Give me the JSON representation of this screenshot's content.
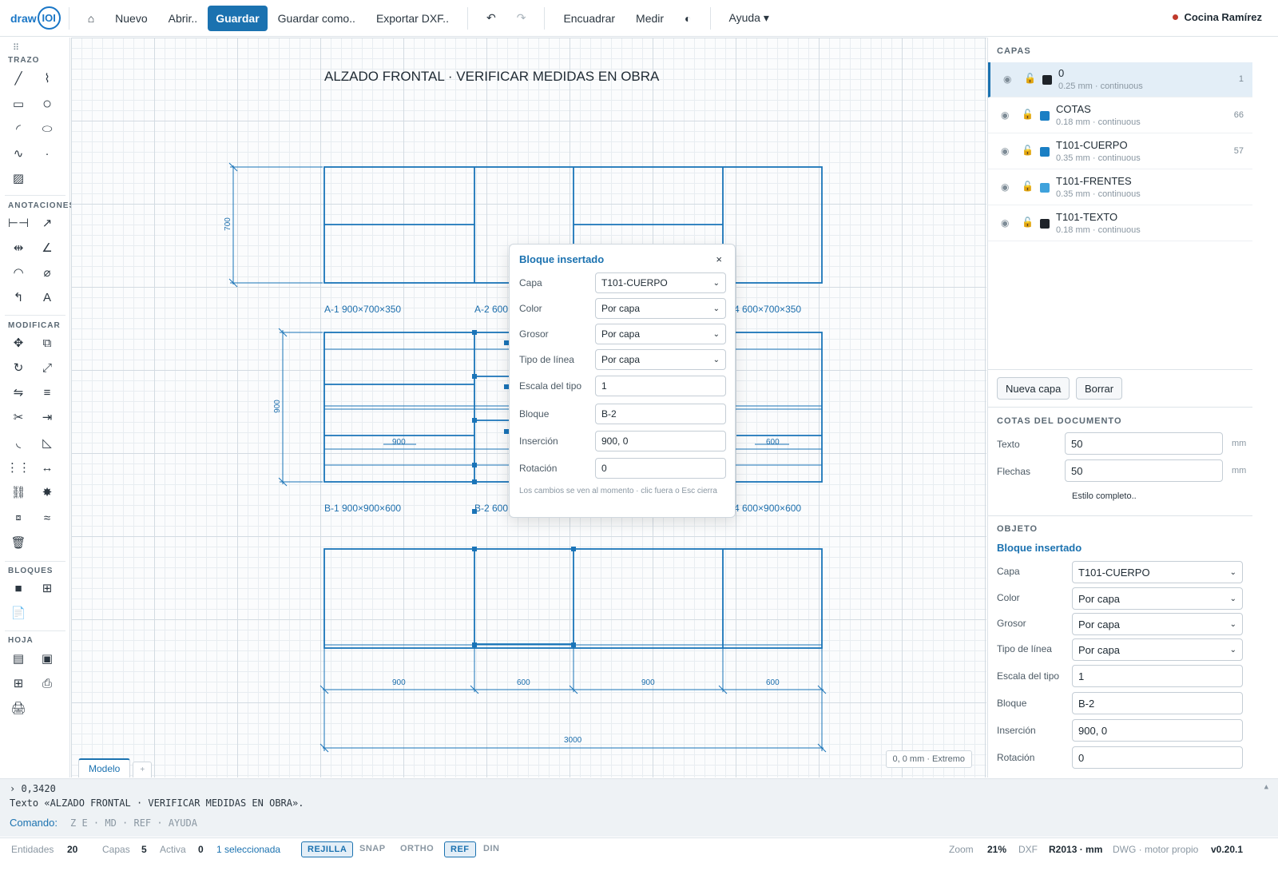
{
  "app": {
    "logo_text": "draw",
    "logo_mark": "IOI",
    "user": "Cocina Ramírez"
  },
  "toolbar": {
    "home_icon": "⌂",
    "new": "Nuevo",
    "open": "Abrir..",
    "save": "Guardar",
    "save_as": "Guardar como..",
    "export_dxf": "Exportar DXF..",
    "undo_icon": "↶",
    "redo_icon": "↷",
    "fit": "Encuadrar",
    "measure": "Medir",
    "theme_icon": "◐",
    "help": "Ayuda ▾"
  },
  "tools": {
    "sections": {
      "trazo": "TRAZO",
      "anotaciones": "ANOTACIONES",
      "modificar": "MODIFICAR",
      "bloques": "BLOQUES",
      "hoja": "HOJA"
    },
    "trazo": [
      "line-icon",
      "polyline-icon",
      "rectangle-icon",
      "circle-icon",
      "arc-icon",
      "ellipse-icon",
      "spline-icon",
      "point-icon",
      "hatch-icon"
    ],
    "anotaciones": [
      "linear-dimension-icon",
      "leader-icon",
      "aligned-dimension-icon",
      "angle-dimension-icon",
      "arc-dimension-icon",
      "diameter-icon",
      "multileader-icon",
      "text-icon"
    ],
    "modificar": [
      "move-icon",
      "copy-icon",
      "rotate-icon",
      "scale-icon",
      "mirror-icon",
      "offset-icon",
      "trim-icon",
      "extend-icon",
      "fillet-icon",
      "chamfer-icon",
      "array-icon",
      "stretch-icon",
      "join-icon",
      "explode-icon",
      "group-icon",
      "match-properties-icon",
      "delete-icon"
    ],
    "bloques": [
      "insert-block-icon",
      "create-block-icon",
      "block-library-icon"
    ],
    "hoja": [
      "sheet-layout-icon",
      "viewport-icon",
      "table-icon",
      "stamp-icon",
      "print-icon"
    ]
  },
  "canvas": {
    "title": "ALZADO FRONTAL · VERIFICAR MEDIDAS EN OBRA",
    "labels": {
      "a1": "A-1  900×700×350",
      "a2": "A-2  600",
      "a4": "4  600×700×350",
      "b1": "B-1  900×900×600",
      "b2": "B-2  600",
      "b4": "4  600×900×600"
    },
    "dims": {
      "h700": "700",
      "h900": "900",
      "mid_900": "900",
      "mid_600": "600",
      "bot_900a": "900",
      "bot_600a": "600",
      "bot_900b": "900",
      "bot_600b": "600",
      "total": "3000"
    },
    "coords": "0, 0 mm · Extremo",
    "tabs": {
      "model": "Modelo",
      "add": "+"
    }
  },
  "popup": {
    "title": "Bloque insertado",
    "close": "×",
    "fields": {
      "layer": {
        "label": "Capa",
        "value": "T101-CUERPO"
      },
      "color": {
        "label": "Color",
        "value": "Por capa"
      },
      "weight": {
        "label": "Grosor",
        "value": "Por capa"
      },
      "linetype": {
        "label": "Tipo de línea",
        "value": "Por capa"
      },
      "ltscale": {
        "label": "Escala del tipo",
        "value": "1"
      },
      "block": {
        "label": "Bloque",
        "value": "B-2"
      },
      "insertion": {
        "label": "Inserción",
        "value": "900, 0"
      },
      "rotation": {
        "label": "Rotación",
        "value": "0"
      }
    },
    "hint": "Los cambios se ven al momento · clic fuera o Esc cierra"
  },
  "layers": {
    "heading": "CAPAS",
    "items": [
      {
        "name": "0",
        "meta": "0.25 mm · continuous",
        "count": "1",
        "color": "#1e2329"
      },
      {
        "name": "COTAS",
        "meta": "0.18 mm · continuous",
        "count": "66",
        "color": "#1a7fc4"
      },
      {
        "name": "T101-CUERPO",
        "meta": "0.35 mm · continuous",
        "count": "57",
        "color": "#1a7fc4"
      },
      {
        "name": "T101-FRENTES",
        "meta": "0.35 mm · continuous",
        "count": "",
        "color": "#3fa2dc"
      },
      {
        "name": "T101-TEXTO",
        "meta": "0.18 mm · continuous",
        "count": "",
        "color": "#1e2329"
      }
    ],
    "new_layer": "Nueva capa",
    "delete": "Borrar"
  },
  "doc_dims": {
    "heading": "COTAS DEL DOCUMENTO",
    "text_label": "Texto",
    "text_value": "50",
    "arrows_label": "Flechas",
    "arrows_value": "50",
    "unit": "mm",
    "full_style": "Estilo completo.."
  },
  "object": {
    "heading": "OBJETO",
    "title": "Bloque insertado",
    "fields": {
      "layer": {
        "label": "Capa",
        "value": "T101-CUERPO"
      },
      "color": {
        "label": "Color",
        "value": "Por capa"
      },
      "weight": {
        "label": "Grosor",
        "value": "Por capa"
      },
      "linetype": {
        "label": "Tipo de línea",
        "value": "Por capa"
      },
      "ltscale": {
        "label": "Escala del tipo",
        "value": "1"
      },
      "block": {
        "label": "Bloque",
        "value": "B-2"
      },
      "insertion": {
        "label": "Inserción",
        "value": "900, 0"
      },
      "rotation": {
        "label": "Rotación",
        "value": "0"
      }
    }
  },
  "console": {
    "line1": "› 0,3420",
    "line2": "Texto «ALZADO FRONTAL · VERIFICAR MEDIDAS EN OBRA».",
    "prompt": "Comando:",
    "hints": "Z E · MD · REF · AYUDA",
    "expand_icon": "▲"
  },
  "status": {
    "entities_label": "Entidades",
    "entities_value": "20",
    "layers_label": "Capas",
    "layers_value": "5",
    "active_label": "Activa",
    "active_value": "0",
    "selected": "1 seleccionada",
    "toggles": {
      "grid": "REJILLA",
      "snap": "SNAP",
      "ortho": "ORTHO",
      "ref": "REF",
      "din": "DIN"
    },
    "zoom_label": "Zoom",
    "zoom_value": "21%",
    "dxf_label": "DXF",
    "dxf_value": "R2013 · mm",
    "engine": "DWG · motor propio",
    "version": "v0.20.1"
  }
}
